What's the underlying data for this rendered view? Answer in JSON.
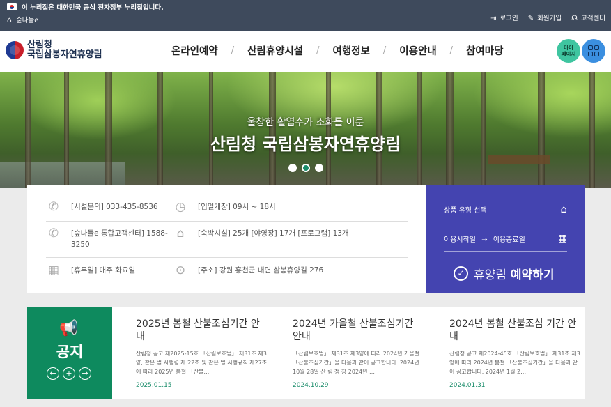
{
  "gov_banner": {
    "notice": "이 누리집은 대한민국 공식 전자정부 누리집입니다.",
    "site_name": "숲나들e",
    "links": [
      {
        "label": "로그인",
        "icon": "login-icon"
      },
      {
        "label": "회원가입",
        "icon": "signup-icon"
      },
      {
        "label": "고객센터",
        "icon": "headset-icon"
      }
    ]
  },
  "header": {
    "logo_line1": "산림청",
    "logo_line2": "국립삼봉자연휴양림",
    "nav": [
      "온라인예약",
      "산림휴양시설",
      "여행정보",
      "이용안내",
      "참여마당"
    ],
    "mypage_label": "마이\n페이지"
  },
  "hero": {
    "subtitle": "울창한 활엽수가 조화를 이룬",
    "title": "산림청 국립삼봉자연휴양림",
    "slides": 3,
    "active_slide": 2
  },
  "info": {
    "phone": "[시설문의] 033-435-8536",
    "hours": "[입일개장] 09시 ~ 18시",
    "center": "[숲나들e 통합고객센터] 1588-3250",
    "facilities": "[숙박시설] 25개 [야영장] 17개 [프로그램] 13개",
    "holiday": "[휴무일] 매주 화요일",
    "address": "[주소] 강원 홍천군 내면 삼봉휴양길 276"
  },
  "booking": {
    "product_type": "상품 유형 선택",
    "start": "이용시작일",
    "arrow": "→",
    "end": "이용종료일",
    "button_prefix": "휴양림",
    "button_label": "예약하기"
  },
  "notice": {
    "title": "공지",
    "items": [
      {
        "title": "2025년 봄철 산불조심기간 안내",
        "body": "산림청 공고 제2025-15호 「산림보호법」 제31조 제3양, 같은 법 시행령 제 22조 및 같은 법 시행규칙 제27조에 따라 2025년 봄철 「산불…",
        "date": "2025.01.15"
      },
      {
        "title": "2024년 가을철 산불조심기간 안내",
        "body": "「산림보호법」 제31조 제3양에 따라 2024년 가을철 「산불조심기간」을 다음과 같이 공고합니다. 2024년 10월 28일 산 림 청 장 2024년 …",
        "date": "2024.10.29"
      },
      {
        "title": "2024년 봄철 산불조심 기간 안내",
        "body": "산림청 공고 제2024-45호 「산림보호법」 제31조 제3양에 따라 2024년 봄철 「산불조심기간」을 다음과 같이 공고합니다. 2024년 1월 2…",
        "date": "2024.01.31"
      }
    ]
  },
  "colors": {
    "gov_bar": "#3e4a5c",
    "booking": "#4444b0",
    "notice_green": "#0e8a5e",
    "date_green": "#1a8c6a"
  }
}
